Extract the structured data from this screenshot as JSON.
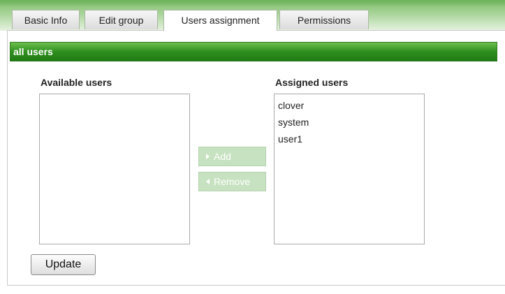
{
  "tabs": [
    {
      "label": "Basic Info",
      "active": false
    },
    {
      "label": "Edit group",
      "active": false
    },
    {
      "label": "Users assignment",
      "active": true
    },
    {
      "label": "Permissions",
      "active": false
    }
  ],
  "panel": {
    "header_title": "all users",
    "available": {
      "label": "Available users",
      "items": []
    },
    "assigned": {
      "label": "Assigned users",
      "items": [
        "clover",
        "system",
        "user1"
      ]
    },
    "buttons": {
      "add": "Add",
      "remove": "Remove",
      "update": "Update"
    }
  },
  "icons": {
    "add": "triangle-right-icon",
    "remove": "triangle-left-icon"
  },
  "colors": {
    "header_green": "#2e8f1e",
    "tab_band_green": "#7fbf6c",
    "disabled_button_green": "#c7e2c0"
  }
}
